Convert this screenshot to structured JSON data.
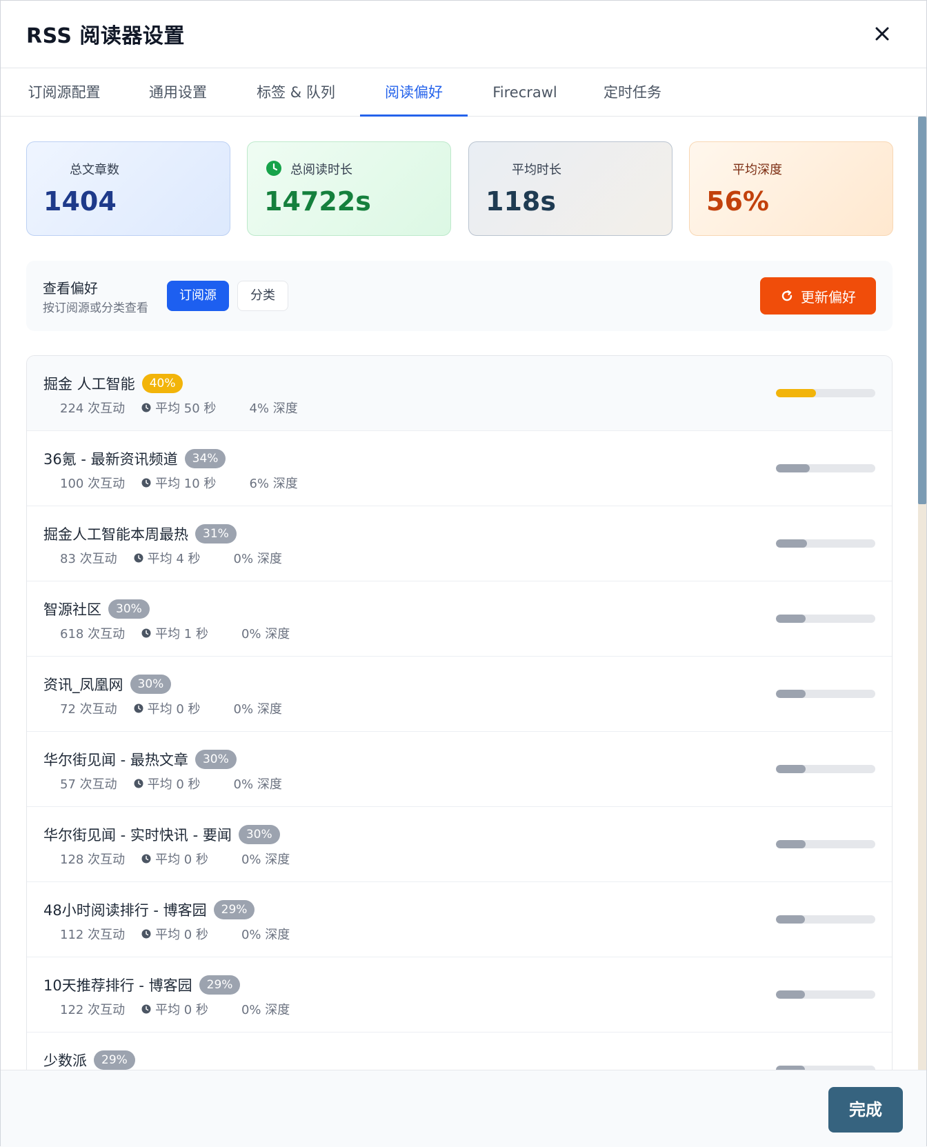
{
  "header": {
    "title": "RSS 阅读器设置"
  },
  "tabs": [
    {
      "label": "订阅源配置"
    },
    {
      "label": "通用设置"
    },
    {
      "label": "标签 & 队列"
    },
    {
      "label": "阅读偏好"
    },
    {
      "label": "Firecrawl"
    },
    {
      "label": "定时任务"
    }
  ],
  "active_tab": "阅读偏好",
  "stats": [
    {
      "label": "总文章数",
      "value": "1404"
    },
    {
      "label": "总阅读时长",
      "value": "14722s",
      "icon": "clock-icon"
    },
    {
      "label": "平均时长",
      "value": "118s"
    },
    {
      "label": "平均深度",
      "value": "56%"
    }
  ],
  "prefs": {
    "title": "查看偏好",
    "subtitle": "按订阅源或分类查看",
    "by_feed": "订阅源",
    "by_category": "分类",
    "refresh_label": "更新偏好"
  },
  "items": [
    {
      "name": "掘金 人工智能",
      "pct": "40%",
      "interactions": "224 次互动",
      "avg": "平均 50 秒",
      "depth": "4% 深度",
      "score": 40
    },
    {
      "name": "36氪 - 最新资讯频道",
      "pct": "34%",
      "interactions": "100 次互动",
      "avg": "平均 10 秒",
      "depth": "6% 深度",
      "score": 34
    },
    {
      "name": "掘金人工智能本周最热",
      "pct": "31%",
      "interactions": "83 次互动",
      "avg": "平均 4 秒",
      "depth": "0% 深度",
      "score": 31
    },
    {
      "name": "智源社区",
      "pct": "30%",
      "interactions": "618 次互动",
      "avg": "平均 1 秒",
      "depth": "0% 深度",
      "score": 30
    },
    {
      "name": "资讯_凤凰网",
      "pct": "30%",
      "interactions": "72 次互动",
      "avg": "平均 0 秒",
      "depth": "0% 深度",
      "score": 30
    },
    {
      "name": "华尔街见闻 - 最热文章",
      "pct": "30%",
      "interactions": "57 次互动",
      "avg": "平均 0 秒",
      "depth": "0% 深度",
      "score": 30
    },
    {
      "name": "华尔街见闻 - 实时快讯 - 要闻",
      "pct": "30%",
      "interactions": "128 次互动",
      "avg": "平均 0 秒",
      "depth": "0% 深度",
      "score": 30
    },
    {
      "name": "48小时阅读排行 - 博客园",
      "pct": "29%",
      "interactions": "112 次互动",
      "avg": "平均 0 秒",
      "depth": "0% 深度",
      "score": 29
    },
    {
      "name": "10天推荐排行 - 博客园",
      "pct": "29%",
      "interactions": "122 次互动",
      "avg": "平均 0 秒",
      "depth": "0% 深度",
      "score": 29
    },
    {
      "name": "少数派",
      "pct": "29%",
      "interactions": "",
      "avg": "",
      "depth": "",
      "score": 29
    }
  ],
  "colors": {
    "accent": "#2563eb",
    "highlight": "#f2b40a",
    "refresh": "#f04d0a",
    "done": "#36637f"
  },
  "footer": {
    "done_label": "完成"
  }
}
